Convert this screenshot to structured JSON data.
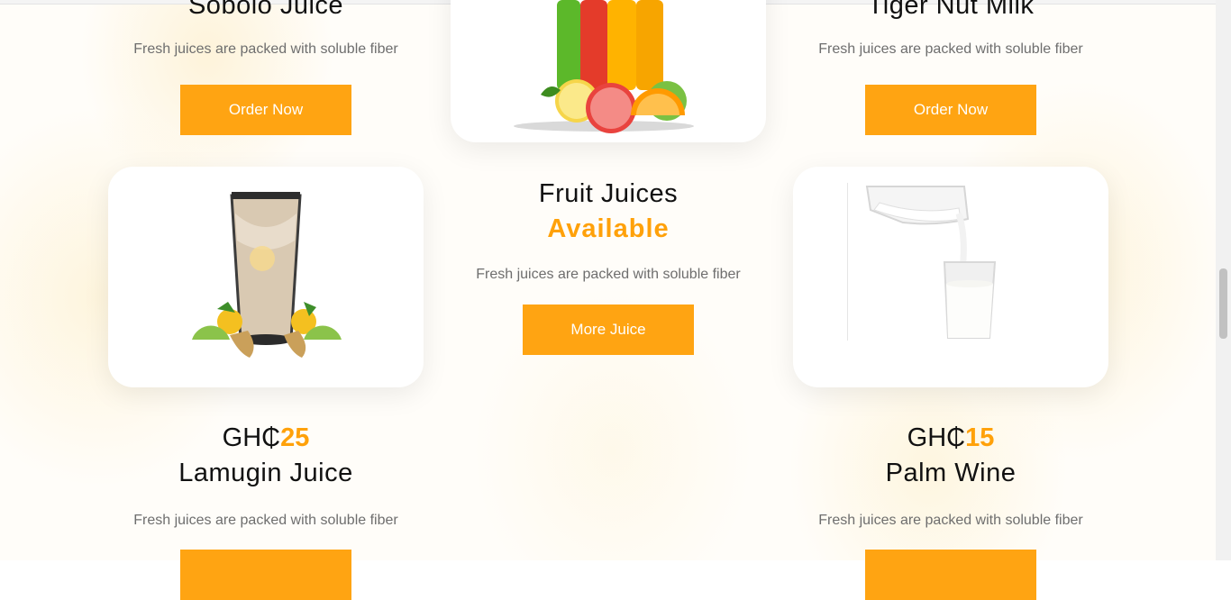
{
  "products": {
    "top_left": {
      "name": "Sobolo Juice",
      "description": "Fresh juices are packed with soluble fiber",
      "button": "Order Now"
    },
    "top_right": {
      "name": "Tiger Nut Milk",
      "description": "Fresh juices are packed with soluble fiber",
      "button": "Order Now"
    },
    "bottom_left": {
      "currency": "GH₵",
      "price": "25",
      "name": "Lamugin Juice",
      "description": "Fresh juices are packed with soluble fiber",
      "button": ""
    },
    "bottom_right": {
      "currency": "GH₵",
      "price": "15",
      "name": "Palm Wine",
      "description": "Fresh juices are packed with soluble fiber",
      "button": ""
    }
  },
  "center": {
    "heading": "Fruit Juices",
    "highlight": "Available",
    "description": "Fresh juices are packed with soluble fiber",
    "button": "More Juice"
  },
  "images": {
    "center_top": "fruit-juice-bottles-image",
    "left_card": "ginger-juice-glass-image",
    "right_card": "milk-pouring-image"
  },
  "colors": {
    "accent": "#ffa412",
    "price_accent": "#ffa10a",
    "text": "#111111",
    "muted": "#6e6e6e"
  }
}
